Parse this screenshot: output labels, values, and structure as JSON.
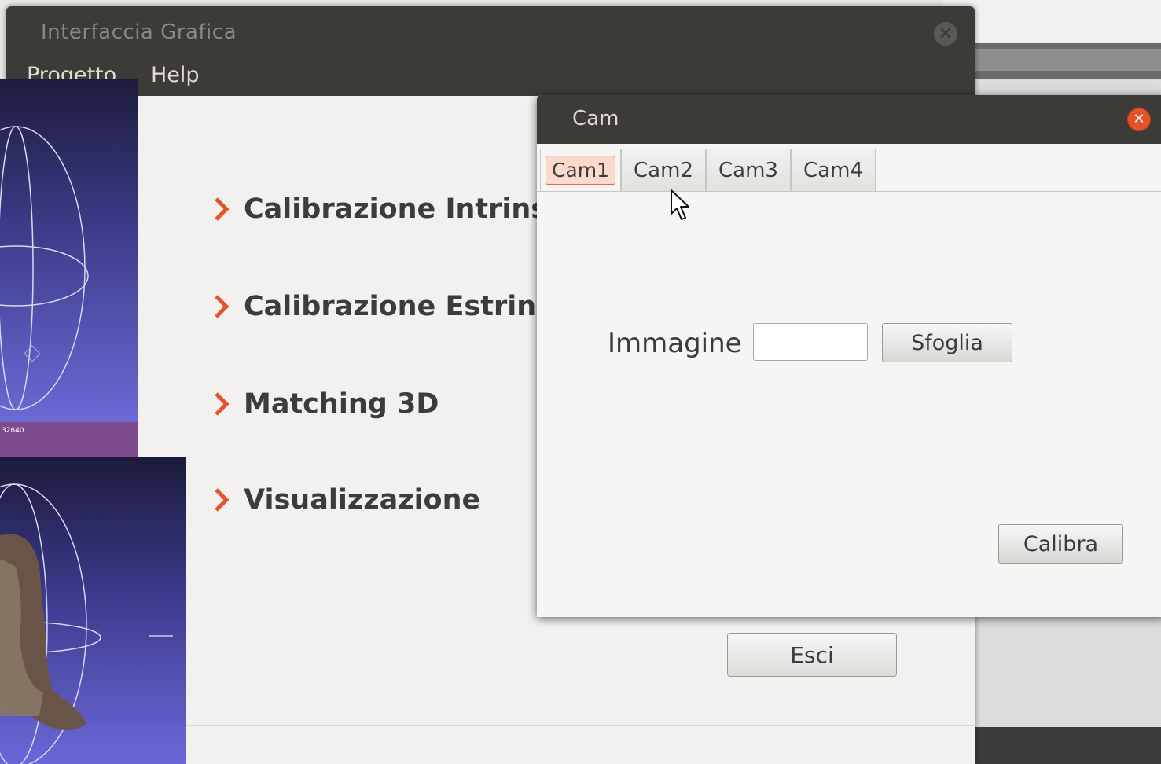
{
  "main_window": {
    "title": "Interfaccia Grafica",
    "menu": [
      "Progetto",
      "Help"
    ],
    "nav_items": [
      "Calibrazione Intrinse",
      "Calibrazione Estrinse",
      "Matching 3D",
      "Visualizzazione"
    ],
    "exit_button": "Esci"
  },
  "viewer_thumb": {
    "status_text": "32640"
  },
  "cam_dialog": {
    "title": "Cam",
    "tabs": [
      "Cam1",
      "Cam2",
      "Cam3",
      "Cam4"
    ],
    "active_tab": "Cam1",
    "image_label": "Immagine",
    "image_value": "",
    "browse_button": "Sfoglia",
    "calibrate_button": "Calibra"
  },
  "colors": {
    "titlebar": "#3c3b37",
    "accent": "#e4532b",
    "viewer_bg": "#6b69d4"
  },
  "icons": [
    "close-icon",
    "chevron-right-icon",
    "mouse-cursor-icon"
  ]
}
